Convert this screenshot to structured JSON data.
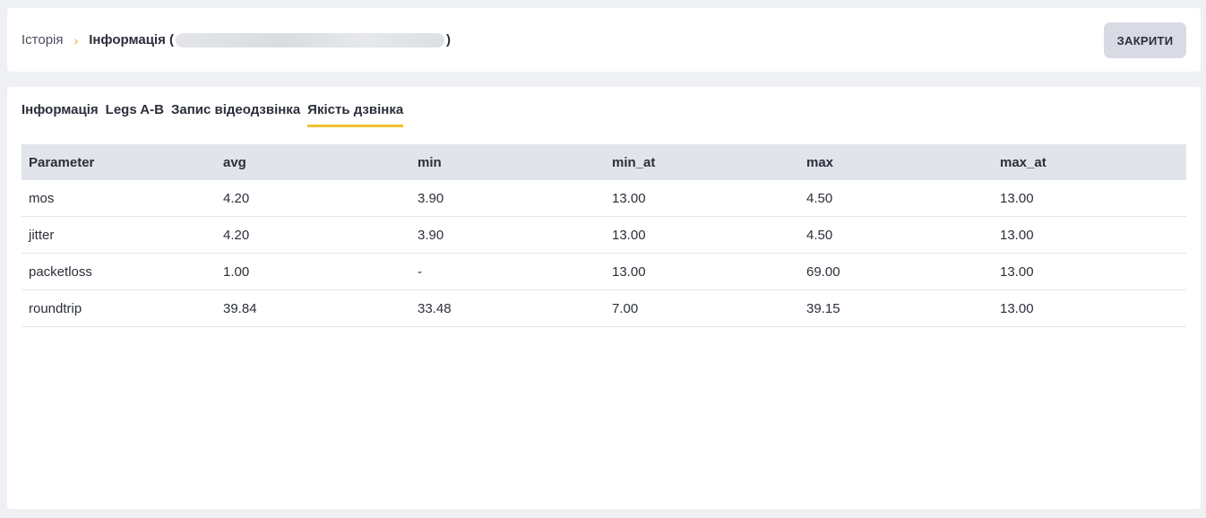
{
  "breadcrumb": {
    "parent": "Історія",
    "separator": "›",
    "current_prefix": "Інформація (",
    "current_suffix": ")"
  },
  "header": {
    "close_label": "ЗАКРИТИ"
  },
  "tabs": [
    {
      "label": "Інформація",
      "active": false
    },
    {
      "label": "Legs A-B",
      "active": false
    },
    {
      "label": "Запис відеодзвінка",
      "active": false
    },
    {
      "label": "Якість дзвінка",
      "active": true
    }
  ],
  "table": {
    "columns": [
      "Parameter",
      "avg",
      "min",
      "min_at",
      "max",
      "max_at"
    ],
    "rows": [
      [
        "mos",
        "4.20",
        "3.90",
        "13.00",
        "4.50",
        "13.00"
      ],
      [
        "jitter",
        "4.20",
        "3.90",
        "13.00",
        "4.50",
        "13.00"
      ],
      [
        "packetloss",
        "1.00",
        "-",
        "13.00",
        "69.00",
        "13.00"
      ],
      [
        "roundtrip",
        "39.84",
        "33.48",
        "7.00",
        "39.15",
        "13.00"
      ]
    ]
  },
  "colors": {
    "accent": "#f2c12e",
    "separator": "#e8a11c",
    "header_bg": "#e1e4ea",
    "page_bg": "#eef0f4"
  }
}
